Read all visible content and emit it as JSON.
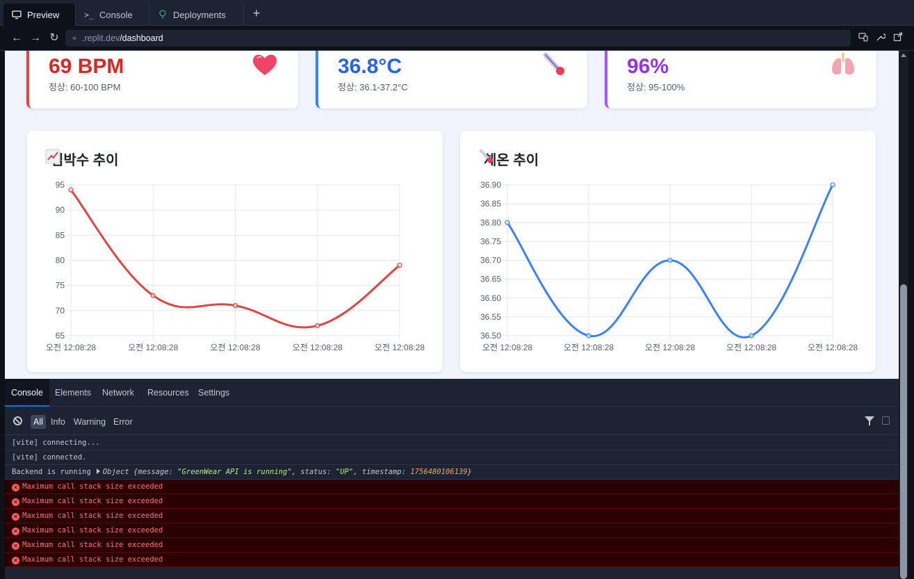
{
  "tabs": [
    {
      "label": "Preview",
      "icon": "monitor-icon"
    },
    {
      "label": "Console",
      "icon": "terminal-icon"
    },
    {
      "label": "Deployments",
      "icon": "deploy-icon"
    }
  ],
  "url": {
    "host": ".replit.dev",
    "path": "/dashboard"
  },
  "stats": [
    {
      "value": "69 BPM",
      "range": "정상: 60-100 BPM",
      "emoji": "❤️",
      "color": "#dc2626",
      "accent": "#e04444"
    },
    {
      "value": "36.8°C",
      "range": "정상: 36.1-37.2°C",
      "emoji": "🌡️",
      "color": "#2563eb",
      "accent": "#3b82f6"
    },
    {
      "value": "96%",
      "range": "정상: 95-100%",
      "emoji": "🫁",
      "color": "#9333ea",
      "accent": "#a855f7"
    }
  ],
  "charts": {
    "heart": {
      "title": "심박수 추이",
      "emoji": "📈"
    },
    "temp": {
      "title": "체온 추이",
      "emoji": "🌡️"
    }
  },
  "chart_data": [
    {
      "type": "line",
      "title": "심박수 추이",
      "categories": [
        "오전 12:08:28",
        "오전 12:08:28",
        "오전 12:08:28",
        "오전 12:08:28",
        "오전 12:08:28"
      ],
      "values": [
        94,
        73,
        71,
        67,
        79
      ],
      "ylim": [
        65,
        95
      ],
      "yticks": [
        "95",
        "90",
        "85",
        "80",
        "75",
        "70",
        "65"
      ],
      "color": "#e04444",
      "grid": true
    },
    {
      "type": "line",
      "title": "체온 추이",
      "categories": [
        "오전 12:08:28",
        "오전 12:08:28",
        "오전 12:08:28",
        "오전 12:08:28",
        "오전 12:08:28"
      ],
      "values": [
        36.8,
        36.5,
        36.7,
        36.5,
        36.9
      ],
      "ylim": [
        36.5,
        36.9
      ],
      "yticks": [
        "36.90",
        "36.85",
        "36.80",
        "36.75",
        "36.70",
        "36.65",
        "36.60",
        "36.55",
        "36.50"
      ],
      "color": "#3b82f6",
      "grid": true
    }
  ],
  "devtools": {
    "tabs": [
      "Console",
      "Elements",
      "Network",
      "Resources",
      "Settings"
    ],
    "filters": [
      "All",
      "Info",
      "Warning",
      "Error"
    ],
    "logs": [
      {
        "text": "[vite] connecting..."
      },
      {
        "text": "[vite] connected."
      },
      {
        "text": "Backend is running",
        "object_label": "Object {",
        "message_key": "message: ",
        "message_val": "\"GreenWear API is running\"",
        "status_key": ", status: ",
        "status_val": "\"UP\"",
        "ts_key": ", timestamp: ",
        "ts_val": "1756480106139",
        "close": "}"
      }
    ],
    "errors": [
      "Maximum call stack size exceeded",
      "Maximum call stack size exceeded",
      "Maximum call stack size exceeded",
      "Maximum call stack size exceeded",
      "Maximum call stack size exceeded",
      "Maximum call stack size exceeded"
    ]
  }
}
